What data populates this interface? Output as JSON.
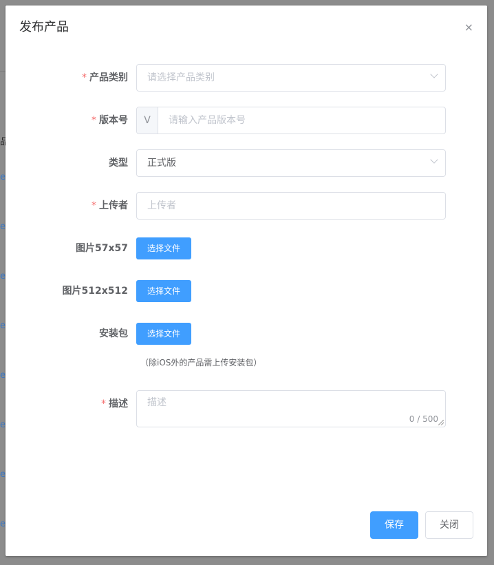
{
  "background": {
    "link_char": "e",
    "partial_char": "品"
  },
  "dialog": {
    "title": "发布产品",
    "close_symbol": "×"
  },
  "form": {
    "category": {
      "label": "产品类别",
      "placeholder": "请选择产品类别",
      "required": true
    },
    "version": {
      "label": "版本号",
      "prefix": "V",
      "placeholder": "请输入产品版本号",
      "required": true
    },
    "type": {
      "label": "类型",
      "value": "正式版",
      "required": false
    },
    "uploader": {
      "label": "上传者",
      "placeholder": "上传者",
      "required": true
    },
    "image57": {
      "label": "图片57x57",
      "button": "选择文件"
    },
    "image512": {
      "label": "图片512x512",
      "button": "选择文件"
    },
    "package": {
      "label": "安装包",
      "button": "选择文件",
      "hint": "（除iOS外的产品需上传安装包）"
    },
    "description": {
      "label": "描述",
      "placeholder": "描述",
      "counter": "0 / 500",
      "required": true
    },
    "required_mark": "*"
  },
  "footer": {
    "save_label": "保存",
    "close_label": "关闭"
  },
  "colors": {
    "primary": "#409eff",
    "required": "#f56c6c",
    "overlay": "#8c8c8c"
  }
}
